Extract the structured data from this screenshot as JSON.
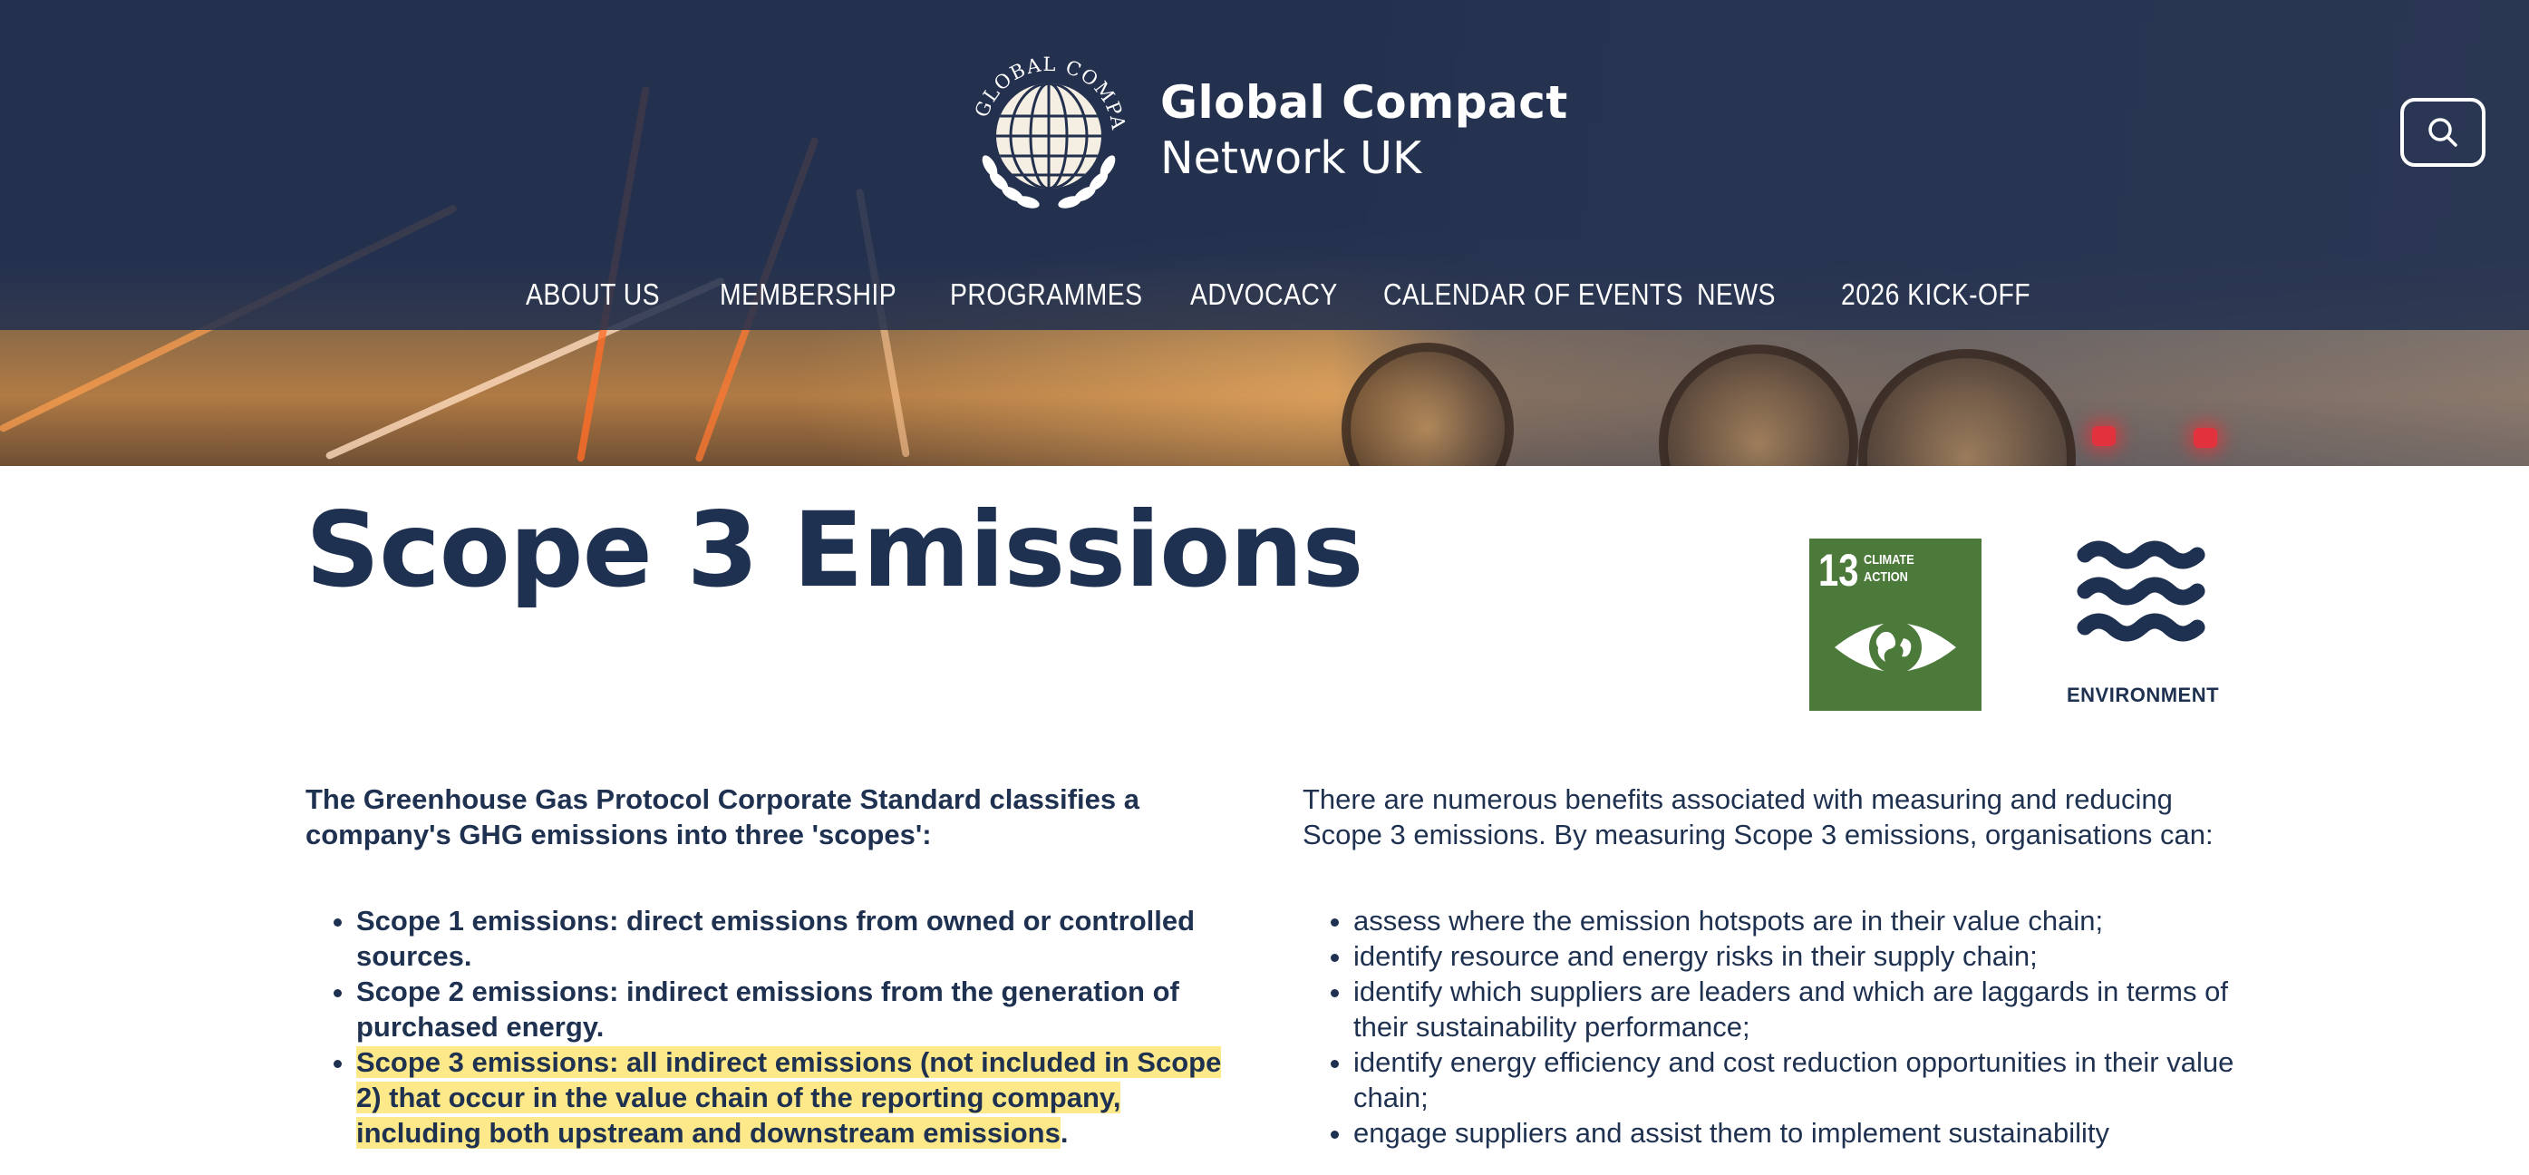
{
  "header": {
    "logo_ring_text": "UN GLOBAL COMPACT",
    "brand_line1": "Global Compact",
    "brand_line2": "Network UK",
    "search_icon": "search-icon"
  },
  "nav": {
    "items": [
      "ABOUT US",
      "MEMBERSHIP",
      "PROGRAMMES",
      "ADVOCACY",
      "CALENDAR OF EVENTS",
      "NEWS",
      "2026 KICK-OFF"
    ]
  },
  "page": {
    "title": "Scope 3 Emissions"
  },
  "badges": {
    "sdg_number": "13",
    "sdg_label_1": "CLIMATE",
    "sdg_label_2": "ACTION",
    "sdg_color": "#4c7a3a",
    "environment_label": "ENVIRONMENT"
  },
  "left": {
    "intro": "The Greenhouse Gas Protocol Corporate Standard classifies a company's GHG emissions into three 'scopes':",
    "bullets": [
      "Scope 1 emissions: direct emissions from owned or controlled sources.",
      "Scope 2 emissions: indirect emissions from the generation of purchased energy."
    ],
    "bullet3_highlight": "Scope 3 emissions: all indirect emissions (not included in Scope 2) that occur in the value chain of the reporting company, including both upstream and downstream emissions",
    "bullet3_tail": "."
  },
  "right": {
    "intro": "There are numerous benefits associated with measuring and reducing Scope 3 emissions. By measuring Scope 3 emissions, organisations can:",
    "bullets": [
      "assess where the emission hotspots are in their value chain;",
      "identify resource and energy risks in their supply chain;",
      "identify which suppliers are leaders and which are laggards in terms of their sustainability performance;",
      "identify energy efficiency and cost reduction opportunities in their value chain;",
      "engage suppliers and assist them to implement sustainability"
    ]
  },
  "colors": {
    "navy": "#1f3150",
    "header_overlay": "#22304e",
    "highlight": "#fde98a"
  }
}
